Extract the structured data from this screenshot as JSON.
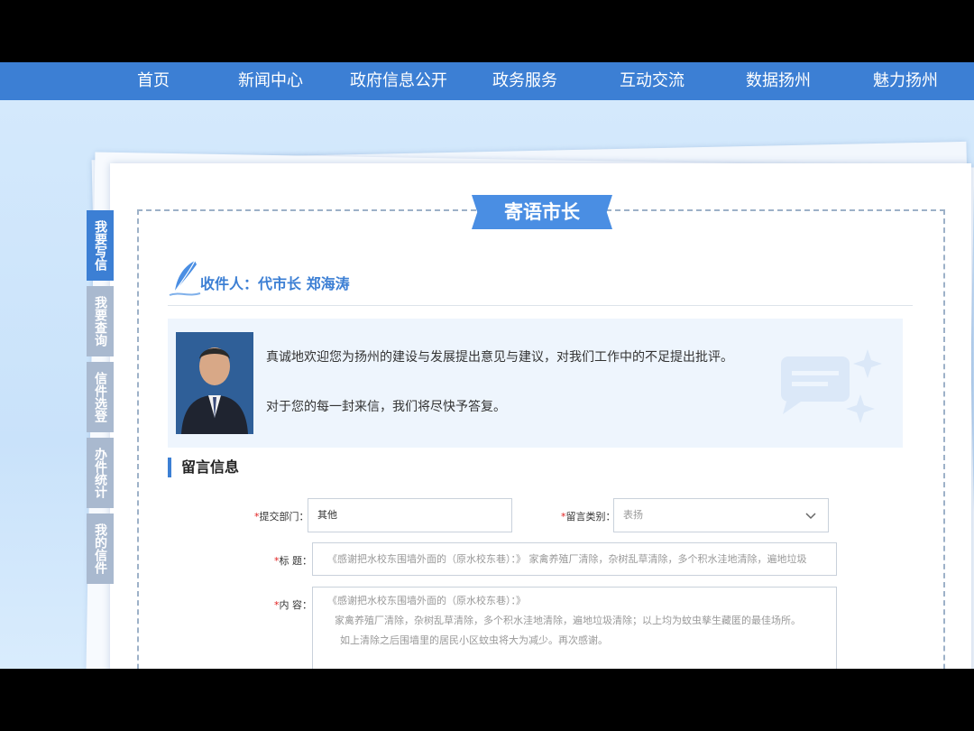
{
  "nav": {
    "items": [
      "首页",
      "新闻中心",
      "政府信息公开",
      "政务服务",
      "互动交流",
      "数据扬州",
      "魅力扬州"
    ]
  },
  "sidetabs": [
    "我要写信",
    "我要查询",
    "信件选登",
    "办件统计",
    "我的信件"
  ],
  "ribbon_title": "寄语市长",
  "recipient": {
    "label": "收件人：代市长 郑海涛"
  },
  "intro": {
    "line1": "真诚地欢迎您为扬州的建设与发展提出意见与建议，对我们工作中的不足提出批评。",
    "line2": "对于您的每一封来信，我们将尽快予答复。"
  },
  "section_title": "留言信息",
  "form": {
    "dept_label": "提交部门：",
    "dept_value": "其他",
    "category_label": "留言类别：",
    "category_value": "表扬",
    "title_label": "标  题：",
    "title_value": "《感谢把水校东围墙外面的（原水校东巷）：》    家禽养殖厂清除，杂树乱草清除，多个积水洼地清除，遍地垃圾",
    "content_label": "内  容：",
    "content_lines": [
      "《感谢把水校东围墙外面的（原水校东巷）：》",
      "家禽养殖厂清除，杂树乱草清除，多个积水洼地清除，遍地垃圾清除；以上均为蚊虫孳生藏匿的最佳场所。",
      "如上清除之后围墙里的居民小区蚊虫将大为减少。再次感谢。"
    ],
    "required_mark": "*"
  },
  "colors": {
    "nav_bg": "#3c7fd4",
    "accent": "#4a8ee3",
    "page_bg": "#cfe6fb"
  }
}
